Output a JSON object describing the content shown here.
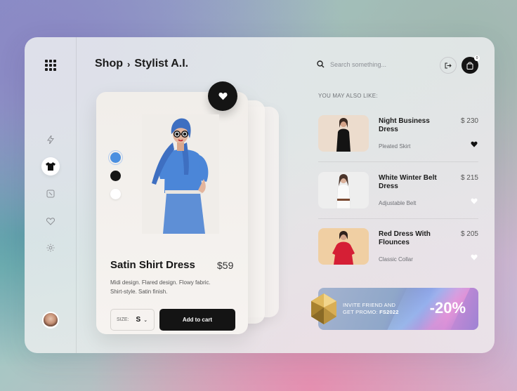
{
  "breadcrumb": {
    "root": "Shop",
    "separator": "›",
    "current": "Stylist A.I."
  },
  "search": {
    "placeholder": "Search something..."
  },
  "cart": {
    "count": "0"
  },
  "product": {
    "name": "Satin Shirt Dress",
    "price": "$59",
    "description": "Midi design. Flared design. Flowy fabric. Shirt-style. Satin finish.",
    "size_label": "SIZE:",
    "size_value": "S",
    "add_to_cart": "Add to cart",
    "colors": [
      "#4a8fe0",
      "#161616",
      "#ffffff"
    ]
  },
  "suggestions": {
    "heading": "YOU MAY ALSO LIKE:",
    "items": [
      {
        "name": "Night Business Dress",
        "price": "$ 230",
        "subtitle": "Pleated Skirt",
        "favorited": true
      },
      {
        "name": "White Winter Belt Dress",
        "price": "$ 215",
        "subtitle": "Adjustable Belt",
        "favorited": false
      },
      {
        "name": "Red Dress With Flounces",
        "price": "$ 205",
        "subtitle": "Classic Collar",
        "favorited": false
      }
    ]
  },
  "promo": {
    "line1": "INVITE FRIEND AND",
    "line2": "GET PROMO:",
    "code": "FS2022",
    "discount": "-20%"
  },
  "icons": {
    "apps": "grid-icon",
    "flash": "lightning-icon",
    "clothes": "tshirt-icon",
    "tag": "tag-icon",
    "favorites": "heart-icon",
    "settings": "gear-icon",
    "search": "search-icon",
    "logout": "logout-icon",
    "cart": "bag-icon"
  }
}
